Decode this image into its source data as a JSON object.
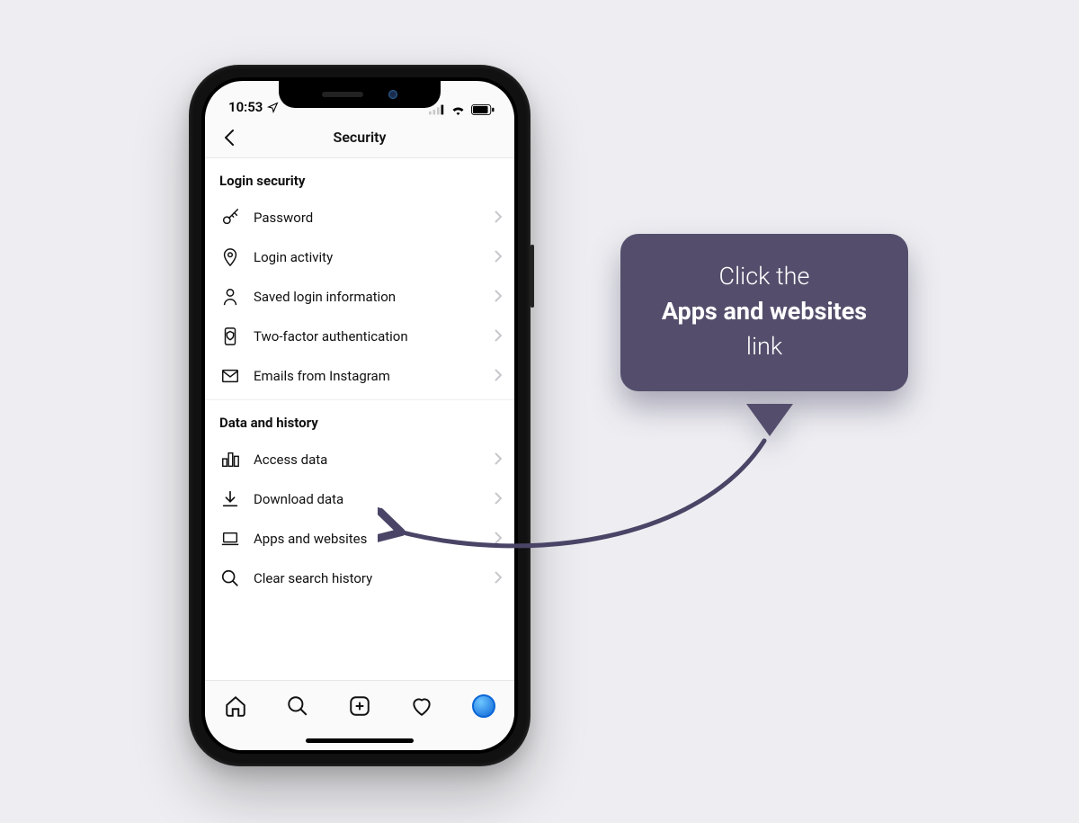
{
  "statusbar": {
    "time": "10:53"
  },
  "nav": {
    "title": "Security"
  },
  "sections": [
    {
      "title": "Login security",
      "items": [
        {
          "icon": "key-icon",
          "label": "Password"
        },
        {
          "icon": "pin-icon",
          "label": "Login activity"
        },
        {
          "icon": "person-icon",
          "label": "Saved login information"
        },
        {
          "icon": "shield-icon",
          "label": "Two-factor authentication"
        },
        {
          "icon": "mail-icon",
          "label": "Emails from Instagram"
        }
      ]
    },
    {
      "title": "Data and history",
      "items": [
        {
          "icon": "chart-icon",
          "label": "Access data"
        },
        {
          "icon": "download-icon",
          "label": "Download data"
        },
        {
          "icon": "laptop-icon",
          "label": "Apps and websites"
        },
        {
          "icon": "search-icon",
          "label": "Clear search history"
        }
      ]
    }
  ],
  "callout": {
    "line1": "Click the",
    "bold": "Apps and websites",
    "line3_suffix": " link"
  },
  "colors": {
    "callout_bg": "#544e6c",
    "arrow": "#4a4566"
  }
}
